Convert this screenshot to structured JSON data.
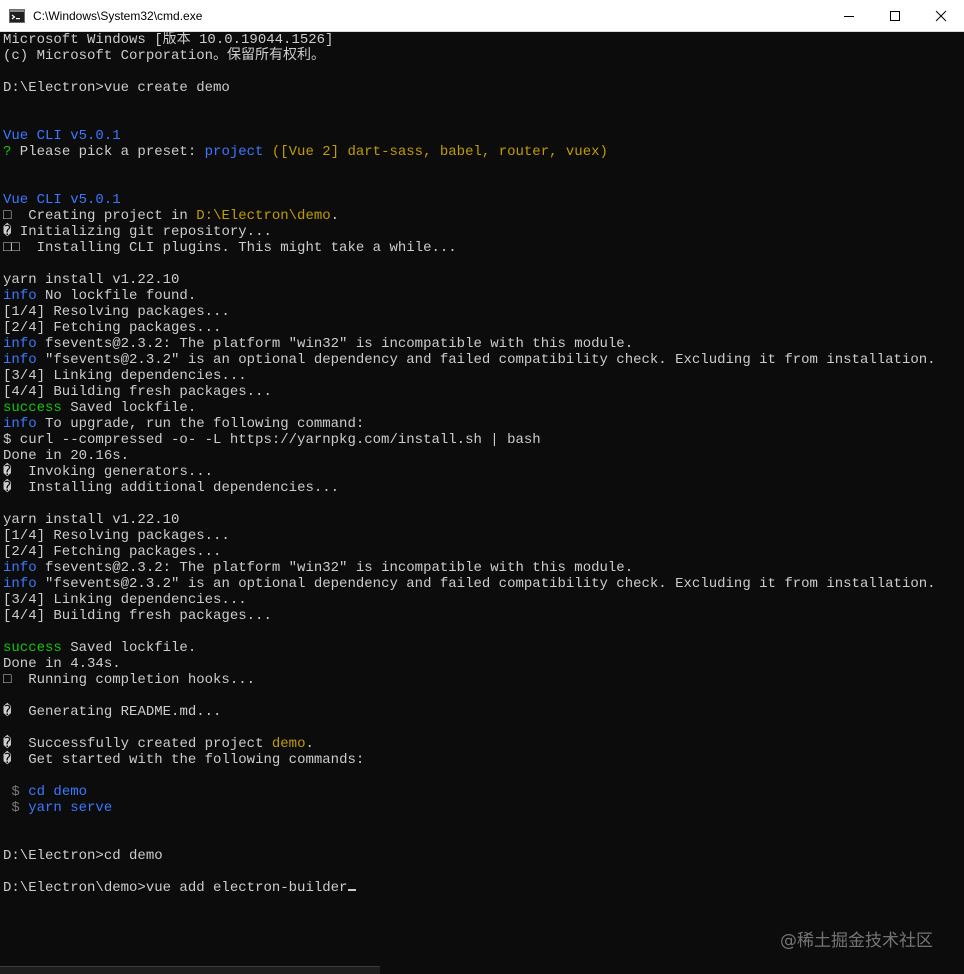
{
  "window": {
    "title": "C:\\Windows\\System32\\cmd.exe"
  },
  "watermark": "@稀土掘金技术社区",
  "colors": {
    "background": "#0c0c0c",
    "text": "#cccccc",
    "blue": "#3b78ff",
    "green": "#16c60c",
    "yellow": "#c19c00"
  },
  "console": {
    "lines": [
      [
        {
          "t": "Microsoft Windows [版本 10.0.19044.1526]"
        }
      ],
      [
        {
          "t": "(c) Microsoft Corporation。保留所有权利。"
        }
      ],
      [],
      [
        {
          "t": "D:\\Electron>vue create demo"
        }
      ],
      [],
      [],
      [
        {
          "t": "Vue CLI v5.0.1",
          "c": "blue"
        }
      ],
      [
        {
          "t": "?",
          "c": "green"
        },
        {
          "t": " Please pick a preset: "
        },
        {
          "t": "project",
          "c": "blue"
        },
        {
          "t": " ([Vue 2] dart-sass, babel, router, vuex)",
          "c": "yellow"
        }
      ],
      [],
      [],
      [
        {
          "t": "Vue CLI v5.0.1",
          "c": "blue"
        }
      ],
      [
        {
          "t": "□  Creating project in "
        },
        {
          "t": "D:\\Electron\\demo",
          "c": "yellow"
        },
        {
          "t": "."
        }
      ],
      [
        {
          "t": "� Initializing git repository..."
        }
      ],
      [
        {
          "t": "□□  Installing CLI plugins. This might take a while..."
        }
      ],
      [],
      [
        {
          "t": "yarn install v1.22.10"
        }
      ],
      [
        {
          "t": "info",
          "c": "blue"
        },
        {
          "t": " No lockfile found."
        }
      ],
      [
        {
          "t": "[1/4] Resolving packages..."
        }
      ],
      [
        {
          "t": "[2/4] Fetching packages..."
        }
      ],
      [
        {
          "t": "info",
          "c": "blue"
        },
        {
          "t": " fsevents@2.3.2: The platform \"win32\" is incompatible with this module."
        }
      ],
      [
        {
          "t": "info",
          "c": "blue"
        },
        {
          "t": " \"fsevents@2.3.2\" is an optional dependency and failed compatibility check. Excluding it from installation."
        }
      ],
      [
        {
          "t": "[3/4] Linking dependencies..."
        }
      ],
      [
        {
          "t": "[4/4] Building fresh packages..."
        }
      ],
      [
        {
          "t": "success",
          "c": "green"
        },
        {
          "t": " Saved lockfile."
        }
      ],
      [
        {
          "t": "info",
          "c": "blue"
        },
        {
          "t": " To upgrade, run the following command:"
        }
      ],
      [
        {
          "t": "$ curl --compressed -o- -L https://yarnpkg.com/install.sh | bash"
        }
      ],
      [
        {
          "t": "Done in 20.16s."
        }
      ],
      [
        {
          "t": "�  Invoking generators..."
        }
      ],
      [
        {
          "t": "�  Installing additional dependencies..."
        }
      ],
      [],
      [
        {
          "t": "yarn install v1.22.10"
        }
      ],
      [
        {
          "t": "[1/4] Resolving packages..."
        }
      ],
      [
        {
          "t": "[2/4] Fetching packages..."
        }
      ],
      [
        {
          "t": "info",
          "c": "blue"
        },
        {
          "t": " fsevents@2.3.2: The platform \"win32\" is incompatible with this module."
        }
      ],
      [
        {
          "t": "info",
          "c": "blue"
        },
        {
          "t": " \"fsevents@2.3.2\" is an optional dependency and failed compatibility check. Excluding it from installation."
        }
      ],
      [
        {
          "t": "[3/4] Linking dependencies..."
        }
      ],
      [
        {
          "t": "[4/4] Building fresh packages..."
        }
      ],
      [],
      [
        {
          "t": "success",
          "c": "green"
        },
        {
          "t": " Saved lockfile."
        }
      ],
      [
        {
          "t": "Done in 4.34s."
        }
      ],
      [
        {
          "t": "□  Running completion hooks..."
        }
      ],
      [],
      [
        {
          "t": "�  Generating README.md..."
        }
      ],
      [],
      [
        {
          "t": "�  Successfully created project "
        },
        {
          "t": "demo",
          "c": "yellow"
        },
        {
          "t": "."
        }
      ],
      [
        {
          "t": "�  Get started with the following commands:"
        }
      ],
      [],
      [
        {
          "t": " $ ",
          "c": "gray"
        },
        {
          "t": "cd demo",
          "c": "blue"
        }
      ],
      [
        {
          "t": " $ ",
          "c": "gray"
        },
        {
          "t": "yarn serve",
          "c": "blue"
        }
      ],
      [],
      [],
      [
        {
          "t": "D:\\Electron>cd demo"
        }
      ],
      [],
      [
        {
          "t": "D:\\Electron\\demo>vue add electron-builder"
        },
        {
          "cursor": true
        }
      ]
    ]
  }
}
